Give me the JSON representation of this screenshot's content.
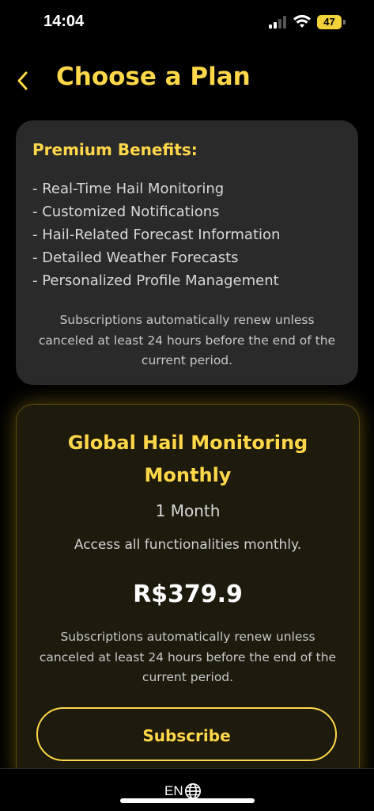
{
  "status_bar": {
    "time": "14:04",
    "battery": "47"
  },
  "header": {
    "back_icon": "chevron-left-icon",
    "title": "Choose a Plan"
  },
  "benefits": {
    "title": "Premium Benefits:",
    "items": [
      "- Real-Time Hail Monitoring",
      "- Customized Notifications",
      "- Hail-Related Forecast Information",
      "- Detailed Weather Forecasts",
      "- Personalized Profile Management"
    ],
    "notice": "Subscriptions automatically renew unless canceled at least 24 hours before the end of the current period."
  },
  "plan": {
    "name_line1": "Global Hail Monitoring",
    "name_line2": "Monthly",
    "duration": "1 Month",
    "description": "Access all functionalities monthly.",
    "price": "R$379.9",
    "notice": "Subscriptions automatically renew unless canceled at least 24 hours before the end of the current period.",
    "subscribe_label": "Subscribe"
  },
  "footer": {
    "language": "EN",
    "language_icon": "globe-icon"
  },
  "colors": {
    "accent": "#ffd84a",
    "background": "#000000",
    "card": "#2a2a2a",
    "plan_card": "#1e1a0c"
  }
}
